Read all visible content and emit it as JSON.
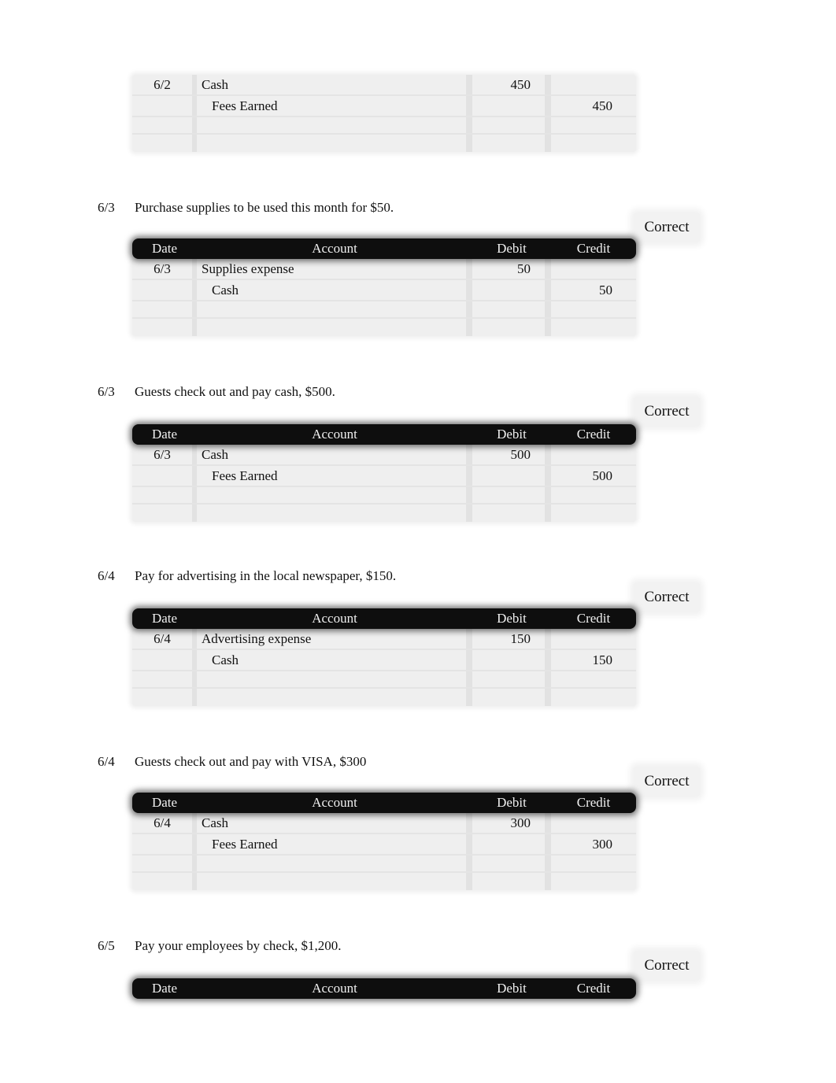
{
  "headers": {
    "date": "Date",
    "account": "Account",
    "debit": "Debit",
    "credit": "Credit"
  },
  "entries": [
    {
      "date": "6/2",
      "description": "",
      "status": "",
      "rows": [
        {
          "date": "6/2",
          "account": "Cash",
          "debit": "450",
          "credit": ""
        },
        {
          "date": "",
          "account": "Fees Earned",
          "debit": "",
          "credit": "450"
        },
        {
          "date": "",
          "account": "",
          "debit": "",
          "credit": ""
        },
        {
          "date": "",
          "account": "",
          "debit": "",
          "credit": ""
        }
      ]
    },
    {
      "date": "6/3",
      "description": "Purchase supplies to be used this month for $50.",
      "status": "Correct",
      "rows": [
        {
          "date": "6/3",
          "account": "Supplies expense",
          "debit": "50",
          "credit": ""
        },
        {
          "date": "",
          "account": "Cash",
          "debit": "",
          "credit": "50"
        },
        {
          "date": "",
          "account": "",
          "debit": "",
          "credit": ""
        },
        {
          "date": "",
          "account": "",
          "debit": "",
          "credit": ""
        }
      ]
    },
    {
      "date": "6/3",
      "description": "Guests check out and pay cash, $500.",
      "status": "Correct",
      "rows": [
        {
          "date": "6/3",
          "account": "Cash",
          "debit": "500",
          "credit": ""
        },
        {
          "date": "",
          "account": "Fees Earned",
          "debit": "",
          "credit": "500"
        },
        {
          "date": "",
          "account": "",
          "debit": "",
          "credit": ""
        },
        {
          "date": "",
          "account": "",
          "debit": "",
          "credit": ""
        }
      ]
    },
    {
      "date": "6/4",
      "description": "Pay for advertising in the local newspaper, $150.",
      "status": "Correct",
      "rows": [
        {
          "date": "6/4",
          "account": "Advertising expense",
          "debit": "150",
          "credit": ""
        },
        {
          "date": "",
          "account": "Cash",
          "debit": "",
          "credit": "150"
        },
        {
          "date": "",
          "account": "",
          "debit": "",
          "credit": ""
        },
        {
          "date": "",
          "account": "",
          "debit": "",
          "credit": ""
        }
      ]
    },
    {
      "date": "6/4",
      "description": "Guests check out and pay with VISA, $300",
      "status": "Correct",
      "rows": [
        {
          "date": "6/4",
          "account": "Cash",
          "debit": "300",
          "credit": ""
        },
        {
          "date": "",
          "account": "Fees Earned",
          "debit": "",
          "credit": "300"
        },
        {
          "date": "",
          "account": "",
          "debit": "",
          "credit": ""
        },
        {
          "date": "",
          "account": "",
          "debit": "",
          "credit": ""
        }
      ]
    },
    {
      "date": "6/5",
      "description": "Pay your employees by check, $1,200.",
      "status": "Correct",
      "rows": []
    }
  ]
}
